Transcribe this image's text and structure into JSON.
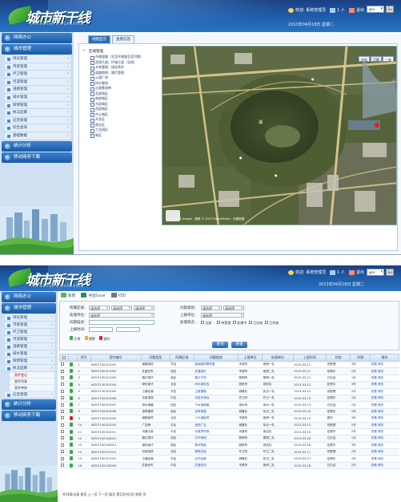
{
  "brand": {
    "logo_text": "城市新干线",
    "logo_sub": "CHENGSHI XINGANXIAN"
  },
  "colors": {
    "header": "#1e5aa6",
    "sidebar": "#cfe0f2",
    "accent": "#2f6fb8"
  },
  "screen1": {
    "header": {
      "user": "欢迎: 系统管理员",
      "count": "1 人",
      "exit": "退出",
      "lang": "gov",
      "go": "Go",
      "date": "2013年04月18日 星期二"
    },
    "sidebar": {
      "sections": [
        {
          "label": "网络办公",
          "icon": "globe-icon"
        },
        {
          "label": "城市管理",
          "icon": "globe-icon"
        }
      ],
      "items": [
        "绿化管理",
        "市容管理",
        "环卫管理",
        "河道管理",
        "道路管理",
        "排水管理",
        "照明管理",
        "执法监察",
        "应急管理",
        "综合查询",
        "基础数据"
      ],
      "bottom": [
        {
          "label": "统计分析",
          "icon": "globe-icon"
        },
        {
          "label": "移动商务下载",
          "icon": "globe-icon"
        }
      ]
    },
    "tabs": [
      "地图显示",
      "查看信息"
    ],
    "tree": {
      "root": "区域管理",
      "nodes": [
        "市政道路（北至环城路至滨河路）",
        "滨湖大道、环城大道（全线）",
        "水库管理、绿化养护",
        "道路照明、路灯管理",
        "公园广场",
        "排水管网",
        "沿湖景观带",
        "北部城区",
        "南部城区",
        "东部城区",
        "西部城区",
        "中心城区",
        "开发区",
        "商业区",
        "工业园区",
        "新区"
      ]
    },
    "map": {
      "buttons": [
        "地图",
        "卫星",
        "三维"
      ],
      "copyright": "© 2013 Google - 图像 © 2013 DigitalGlobe - 地图数据"
    }
  },
  "screen2": {
    "header": {
      "user": "欢迎: 系统管理员",
      "count": "1 人",
      "exit": "退出",
      "lang": "gov",
      "go": "Go",
      "date": "2013年04月18日 星期二"
    },
    "sidebar": {
      "sections": [
        {
          "label": "网络办公",
          "icon": "globe-icon"
        },
        {
          "label": "城市管理",
          "icon": "globe-icon"
        }
      ],
      "items": [
        "绿化管理",
        "市容管理",
        "环卫管理",
        "河道管理",
        "道路管理",
        "排水管理",
        "照明管理",
        "执法监察",
        "应急管理"
      ],
      "deep": [
        "案件登记",
        "案件列表",
        "案件审核"
      ],
      "deep_active": 0,
      "bottom": [
        {
          "label": "统计分析",
          "icon": "globe-icon"
        },
        {
          "label": "移动商务下载",
          "icon": "globe-icon"
        }
      ]
    },
    "toolbar": {
      "new": "新增",
      "export": "导出Excel",
      "print": "打印"
    },
    "filter": {
      "labels": [
        "所属区域：",
        "处理单位：",
        "问题描述：",
        "上报时间：",
        "问题类别：",
        "上报单位：",
        "处理状态："
      ],
      "selects": [
        "请选择",
        "请选择",
        "请选择",
        "请选择",
        "请选择"
      ],
      "options": [
        "全部",
        "待受理",
        "处理中",
        "已办结",
        "已作废"
      ],
      "status_legend": [
        "正常",
        "预警",
        "超时"
      ],
      "buttons": [
        "查询",
        "重置"
      ]
    },
    "grid": {
      "headers": [
        "序号",
        "案件编号",
        "问题类型",
        "所属区域",
        "问题描述",
        "上报单位",
        "处理单位",
        "上报时间",
        "状态",
        "时限",
        "操作"
      ],
      "rows": [
        [
          "1",
          "WZCF130311001",
          "道路破损",
          "东区",
          "路面破损需修复",
          "市政所",
          "维修一队",
          "2013-03-11",
          "待受理",
          "3天",
          "查看 修改"
        ],
        [
          "2",
          "WZCF130311002",
          "井盖丢失",
          "西区",
          "井盖缺失",
          "市政所",
          "维修二队",
          "2013-03-11",
          "处理中",
          "2天",
          "查看 修改"
        ],
        [
          "3",
          "WZCF130311003",
          "路灯损坏",
          "南区",
          "路灯不亮",
          "照明所",
          "照明一队",
          "2013-03-11",
          "已办结",
          "1天",
          "查看 修改"
        ],
        [
          "4",
          "WZCF130312004",
          "绿化破坏",
          "北区",
          "树木被砍伐",
          "园林所",
          "绿化队",
          "2013-03-12",
          "处理中",
          "3天",
          "查看 修改"
        ],
        [
          "5",
          "WZCF130312005",
          "占道经营",
          "东区",
          "占道摆摊",
          "城管队",
          "执法一队",
          "2013-03-12",
          "待受理",
          "2天",
          "查看 修改"
        ],
        [
          "6",
          "WZCF130313006",
          "垃圾堆放",
          "中区",
          "垃圾未清运",
          "环卫所",
          "环卫一队",
          "2013-03-13",
          "处理中",
          "1天",
          "查看 修改"
        ],
        [
          "7",
          "WZCF130313007",
          "排水堵塞",
          "西区",
          "下水道堵塞",
          "排水所",
          "排水一队",
          "2013-03-13",
          "已办结",
          "2天",
          "查看 修改"
        ],
        [
          "8",
          "WZCF130314008",
          "违章建筑",
          "南区",
          "违章搭建",
          "城管队",
          "执法二队",
          "2013-03-14",
          "处理中",
          "5天",
          "查看 修改"
        ],
        [
          "9",
          "WZCF130314009",
          "道路破损",
          "北区",
          "人行道破损",
          "市政所",
          "维修一队",
          "2013-03-14",
          "超时",
          "3天",
          "查看 修改"
        ],
        [
          "10",
          "WZCF130315010",
          "广告牌",
          "东区",
          "违规广告",
          "城管队",
          "执法一队",
          "2013-03-15",
          "待受理",
          "2天",
          "查看 修改"
        ],
        [
          "11",
          "WZCF130315011",
          "河道污染",
          "中区",
          "河道漂浮物",
          "河道所",
          "保洁队",
          "2013-03-15",
          "处理中",
          "2天",
          "查看 修改"
        ],
        [
          "12",
          "WZCF130316012",
          "路灯损坏",
          "西区",
          "灯杆倾斜",
          "照明所",
          "照明二队",
          "2013-03-16",
          "已办结",
          "1天",
          "查看 修改"
        ],
        [
          "13",
          "WZCF130316013",
          "绿化破坏",
          "南区",
          "草坪践踏",
          "园林所",
          "绿化队",
          "2013-03-16",
          "处理中",
          "3天",
          "查看 修改"
        ],
        [
          "14",
          "WZCF130317014",
          "垃圾堆放",
          "北区",
          "建筑垃圾",
          "环卫所",
          "环卫二队",
          "2013-03-17",
          "待受理",
          "2天",
          "查看 修改"
        ],
        [
          "15",
          "WZCF130317015",
          "占道经营",
          "东区",
          "店外经营",
          "城管队",
          "执法二队",
          "2013-03-17",
          "处理中",
          "1天",
          "查看 修改"
        ],
        [
          "16",
          "WZCF130318016",
          "井盖丢失",
          "中区",
          "井盖松动",
          "市政所",
          "维修二队",
          "2013-03-18",
          "已办结",
          "2天",
          "查看 修改"
        ]
      ],
      "flags": [
        "green",
        "green",
        "green",
        "green",
        "green",
        "green",
        "green",
        "green",
        "red",
        "green",
        "green",
        "green",
        "green",
        "green",
        "green",
        "green"
      ]
    },
    "pager": "共16条记录 首页 上一页 下一页 尾页 第1页/共1页 转到 页"
  }
}
